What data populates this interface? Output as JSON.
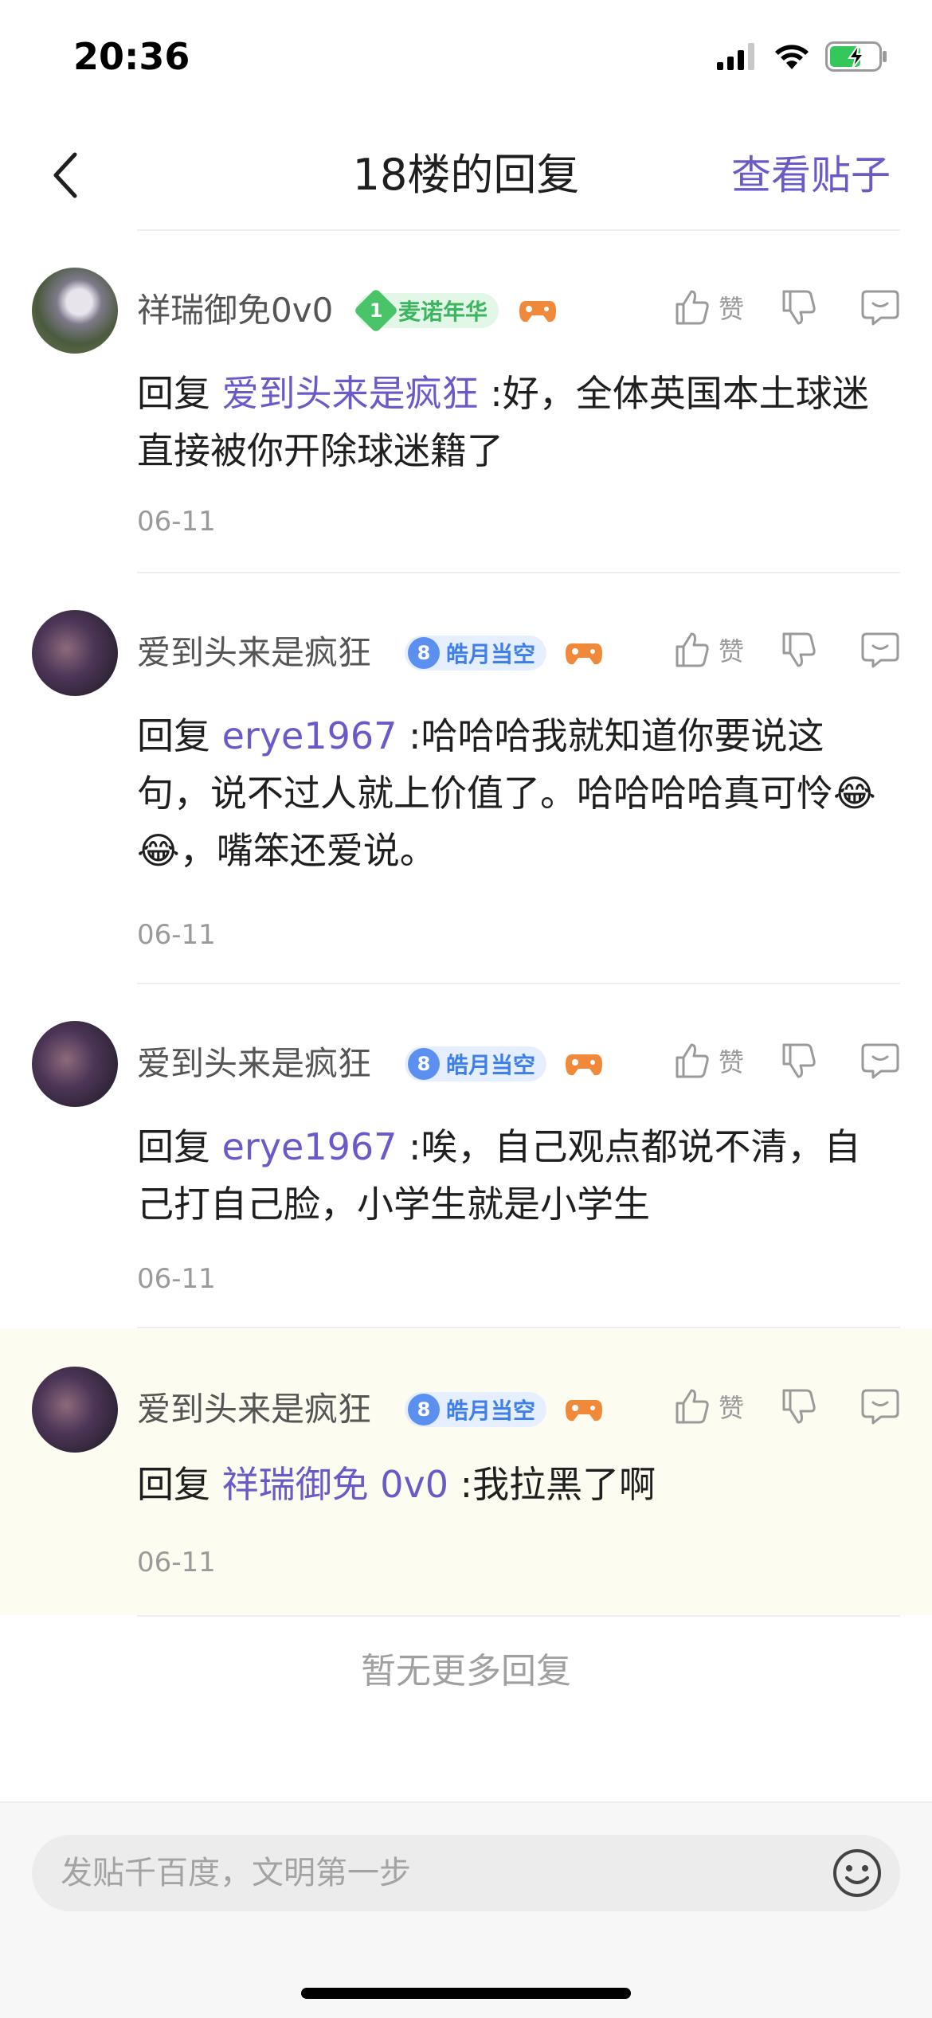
{
  "status_bar": {
    "time": "20:36"
  },
  "nav": {
    "title": "18楼的回复",
    "view_post": "查看贴子"
  },
  "actions": {
    "like_label": "赞"
  },
  "replies": [
    {
      "username": "祥瑞御免0v0",
      "badge_level": "1",
      "badge_title": "麦诺年华",
      "reply_prefix": "回复 ",
      "mention": "爱到头来是疯狂",
      "content": " :好，全体英国本土球迷直接被你开除球迷籍了",
      "date": "06-11"
    },
    {
      "username": "爱到头来是疯狂",
      "badge_level": "8",
      "badge_title": "皓月当空",
      "reply_prefix": "回复 ",
      "mention": "erye1967",
      "content": " :哈哈哈我就知道你要说这句，说不过人就上价值了。哈哈哈哈真可怜",
      "emoji": "😂😂",
      "content_tail": "，嘴笨还爱说。",
      "date": "06-11"
    },
    {
      "username": "爱到头来是疯狂",
      "badge_level": "8",
      "badge_title": "皓月当空",
      "reply_prefix": "回复 ",
      "mention": "erye1967",
      "content": " :唉，自己观点都说不清，自己打自己脸，小学生就是小学生",
      "date": "06-11"
    },
    {
      "username": "爱到头来是疯狂",
      "badge_level": "8",
      "badge_title": "皓月当空",
      "reply_prefix": "回复 ",
      "mention": "祥瑞御免 0v0",
      "content": " :我拉黑了啊",
      "date": "06-11"
    }
  ],
  "footer": {
    "no_more": "暂无更多回复"
  },
  "input": {
    "placeholder": "发贴千百度，文明第一步"
  },
  "colors": {
    "accent": "#6a5ac8",
    "highlight_bg": "#fdfcf0"
  }
}
